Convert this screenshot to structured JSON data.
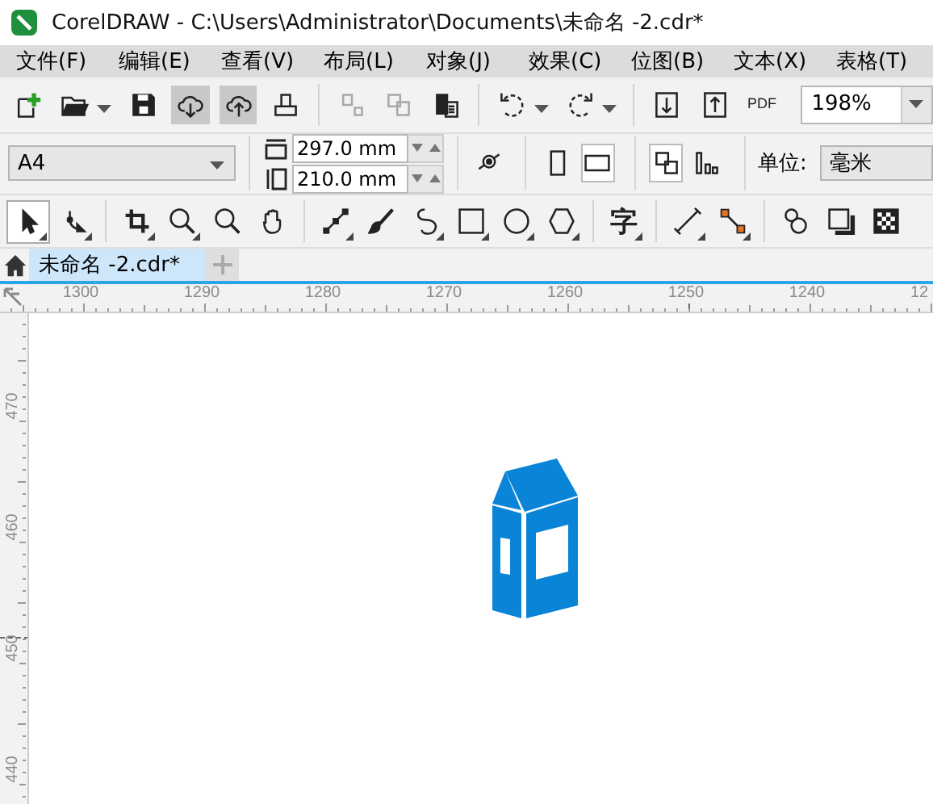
{
  "window": {
    "title": "CorelDRAW - C:\\Users\\Administrator\\Documents\\未命名 -2.cdr*"
  },
  "menu": [
    "文件(F)",
    "编辑(E)",
    "查看(V)",
    "布局(L)",
    "对象(J)",
    "效果(C)",
    "位图(B)",
    "文本(X)",
    "表格(T)"
  ],
  "toolbar": [
    {
      "kind": "new",
      "selected": false,
      "disabled": false,
      "dropdown": false
    },
    {
      "kind": "open",
      "selected": false,
      "disabled": false,
      "dropdown": true
    },
    {
      "kind": "save",
      "selected": false,
      "disabled": false,
      "dropdown": false
    },
    {
      "kind": "cloud-down",
      "selected": true,
      "disabled": false,
      "dropdown": false
    },
    {
      "kind": "cloud-up",
      "selected": true,
      "disabled": false,
      "dropdown": false
    },
    {
      "kind": "print",
      "selected": false,
      "disabled": false,
      "dropdown": false
    },
    {
      "kind": "separator"
    },
    {
      "kind": "cut",
      "selected": false,
      "disabled": true,
      "dropdown": false
    },
    {
      "kind": "copy",
      "selected": false,
      "disabled": true,
      "dropdown": false
    },
    {
      "kind": "paste",
      "selected": false,
      "disabled": false,
      "dropdown": false
    },
    {
      "kind": "separator"
    },
    {
      "kind": "undo",
      "selected": false,
      "disabled": false,
      "dropdown": true
    },
    {
      "kind": "redo",
      "selected": false,
      "disabled": false,
      "dropdown": true
    },
    {
      "kind": "separator"
    },
    {
      "kind": "import",
      "selected": false,
      "disabled": false,
      "dropdown": false
    },
    {
      "kind": "export",
      "selected": false,
      "disabled": false,
      "dropdown": false
    },
    {
      "kind": "pdf",
      "label": "PDF",
      "selected": false,
      "disabled": false,
      "dropdown": false
    }
  ],
  "zoom": {
    "value": "198%"
  },
  "property_bar": {
    "page_size": "A4",
    "width": "297.0 mm",
    "height": "210.0 mm",
    "orientation": [
      {
        "kind": "portrait",
        "selected": false
      },
      {
        "kind": "landscape",
        "selected": true
      }
    ],
    "page_options": [
      {
        "kind": "all-pages",
        "selected": true
      },
      {
        "kind": "layout",
        "selected": false
      }
    ],
    "unit_label": "单位:",
    "unit": "毫米"
  },
  "tools": [
    {
      "kind": "pick",
      "selected": true
    },
    {
      "kind": "shape",
      "selected": false
    },
    {
      "kind": "separator"
    },
    {
      "kind": "crop",
      "selected": false
    },
    {
      "kind": "zoom",
      "selected": false
    },
    {
      "kind": "zoom-plain",
      "selected": false
    },
    {
      "kind": "pan",
      "selected": false
    },
    {
      "kind": "separator"
    },
    {
      "kind": "line",
      "selected": false
    },
    {
      "kind": "brush",
      "selected": false
    },
    {
      "kind": "curve",
      "selected": false
    },
    {
      "kind": "rect",
      "selected": false
    },
    {
      "kind": "ellipse",
      "selected": false
    },
    {
      "kind": "polygon",
      "selected": false
    },
    {
      "kind": "separator"
    },
    {
      "kind": "text",
      "label": "字",
      "selected": false
    },
    {
      "kind": "separator"
    },
    {
      "kind": "dimension",
      "selected": false
    },
    {
      "kind": "connector",
      "selected": false
    },
    {
      "kind": "separator"
    },
    {
      "kind": "blend",
      "selected": false
    },
    {
      "kind": "shadow",
      "selected": false
    },
    {
      "kind": "transparency",
      "selected": false
    }
  ],
  "tabs": [
    {
      "label": "未命名 -2.cdr*",
      "selected": true
    }
  ],
  "ruler_h": [
    "1300",
    "1290",
    "1280",
    "1270",
    "1260",
    "1250",
    "1240",
    "12"
  ],
  "ruler_v": [
    "470",
    "460",
    "450",
    "440"
  ]
}
